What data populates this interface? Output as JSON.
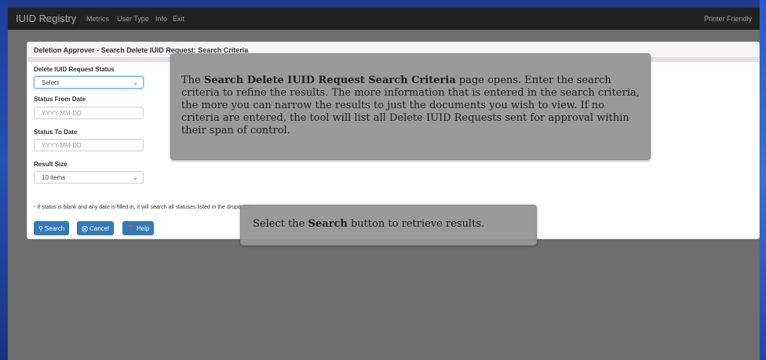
{
  "navbar": {
    "brand": "IUID Registry",
    "links": [
      "Metrics",
      "User Type",
      "Info",
      "Exit"
    ],
    "printer_friendly": "Printer Friendly"
  },
  "panel": {
    "title": "Deletion Approver - Search Delete IUID Request: Search Criteria",
    "status_label": "Delete IUID Request Status",
    "status_value": "Select",
    "from_label": "Status From Date",
    "from_placeholder": "YYYY-MM-DD",
    "to_label": "Status To Date",
    "to_placeholder": "YYYY-MM-DD",
    "size_label": "Result Size",
    "size_value": "10 items",
    "note": "- If status is blank and any date is filled in, it will search all statuses listed in the dropdown",
    "buttons": {
      "search": "Search",
      "cancel": "Cancel",
      "help": "Help"
    }
  },
  "callout1": {
    "pre": "The ",
    "bold": "Search Delete IUID Request Search Criteria",
    "post": " page opens. Enter the search criteria to refine the results. The more information that is entered in the search criteria, the more you can narrow the results to just the documents you wish to view. If no criteria are entered, the tool will list all Delete IUID Requests sent for approval within their span of control."
  },
  "callout2": {
    "pre": "Select the ",
    "bold": "Search",
    "post": " button to retrieve results."
  },
  "colors": {
    "navbar": "#222222",
    "primary_button": "#337ab7",
    "overlay": "#6e6e6e",
    "callout": "#969696"
  }
}
